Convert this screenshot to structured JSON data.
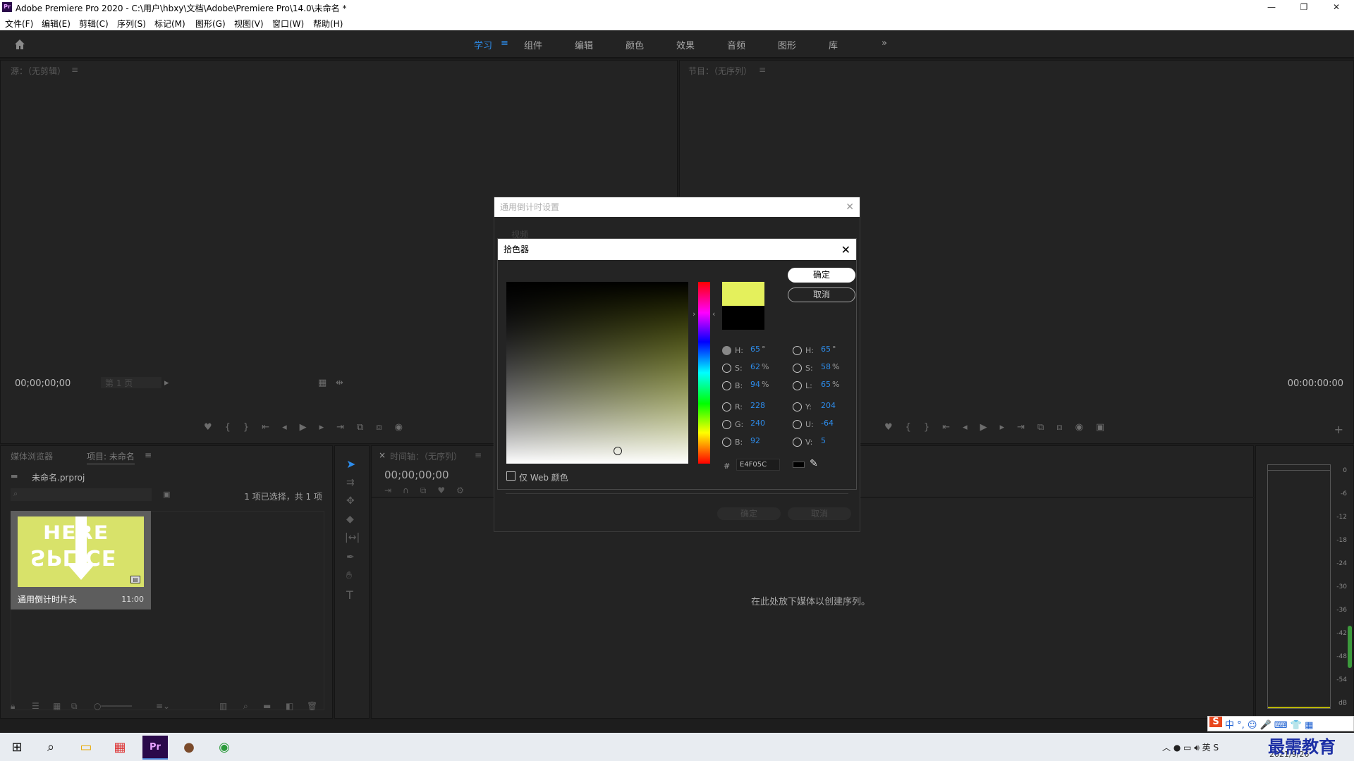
{
  "window": {
    "title": "Adobe Premiere Pro 2020 - C:\\用户\\hbxy\\文档\\Adobe\\Premiere Pro\\14.0\\未命名 *",
    "logo": "Pr",
    "minimize": "—",
    "restore": "❐",
    "close": "✕"
  },
  "menu": [
    "文件(F)",
    "编辑(E)",
    "剪辑(C)",
    "序列(S)",
    "标记(M)",
    "图形(G)",
    "视图(V)",
    "窗口(W)",
    "帮助(H)"
  ],
  "workspaces": {
    "items": [
      "学习",
      "组件",
      "编辑",
      "颜色",
      "效果",
      "音频",
      "图形",
      "库"
    ],
    "active": "学习",
    "overflow": "»",
    "menu_icon": "≡"
  },
  "source": {
    "title": "源：（无剪辑）",
    "menu": "≡",
    "timecode": "00;00;00;00",
    "page": "第 1 页"
  },
  "program": {
    "title": "节目：（无序列）",
    "menu": "≡",
    "timecode": "00:00:00:00"
  },
  "project": {
    "tab1": "媒体浏览器",
    "tab2": "项目: 未命名",
    "menu": "≡",
    "file": "未命名.prproj",
    "selection": "1 项已选择，共 1 项",
    "clip_name": "通用倒计时片头",
    "clip_duration": "11:00",
    "thumb_top": "HERE",
    "thumb_bottom": "SPLICE"
  },
  "timeline": {
    "close": "×",
    "title": "时间轴：（无序列）",
    "menu": "≡",
    "timecode": "00;00;00;00",
    "empty_msg": "在此处放下媒体以创建序列。"
  },
  "meter": {
    "labels": [
      "0",
      "-6",
      "-12",
      "-18",
      "-24",
      "-30",
      "-36",
      "-42",
      "-48",
      "-54",
      "dB"
    ]
  },
  "bg_dialog": {
    "title": "通用倒计时设置",
    "section": "视频",
    "ok": "确定",
    "cancel": "取消"
  },
  "picker": {
    "title": "拾色器",
    "ok": "确定",
    "cancel": "取消",
    "web_only": "仅 Web 颜色",
    "new_color": "#E4F05C",
    "old_color": "#000000",
    "hsb": [
      {
        "label": "H:",
        "value": "65",
        "unit": "°"
      },
      {
        "label": "S:",
        "value": "62",
        "unit": "%"
      },
      {
        "label": "B:",
        "value": "94",
        "unit": "%"
      }
    ],
    "rgb": [
      {
        "label": "R:",
        "value": "228"
      },
      {
        "label": "G:",
        "value": "240"
      },
      {
        "label": "B:",
        "value": "92"
      }
    ],
    "hsl": [
      {
        "label": "H:",
        "value": "65",
        "unit": "°"
      },
      {
        "label": "S:",
        "value": "58",
        "unit": "%"
      },
      {
        "label": "L:",
        "value": "65",
        "unit": "%"
      }
    ],
    "yuv": [
      {
        "label": "Y:",
        "value": "204"
      },
      {
        "label": "U:",
        "value": "-64"
      },
      {
        "label": "V:",
        "value": "5"
      }
    ],
    "hex_label": "#",
    "hex": "E4F05C"
  },
  "ime": "中 °, ☺ 🎤 ⌨ 👕 ▦",
  "tray": {
    "date": "2021/9/26",
    "watermark": "最需教育"
  }
}
